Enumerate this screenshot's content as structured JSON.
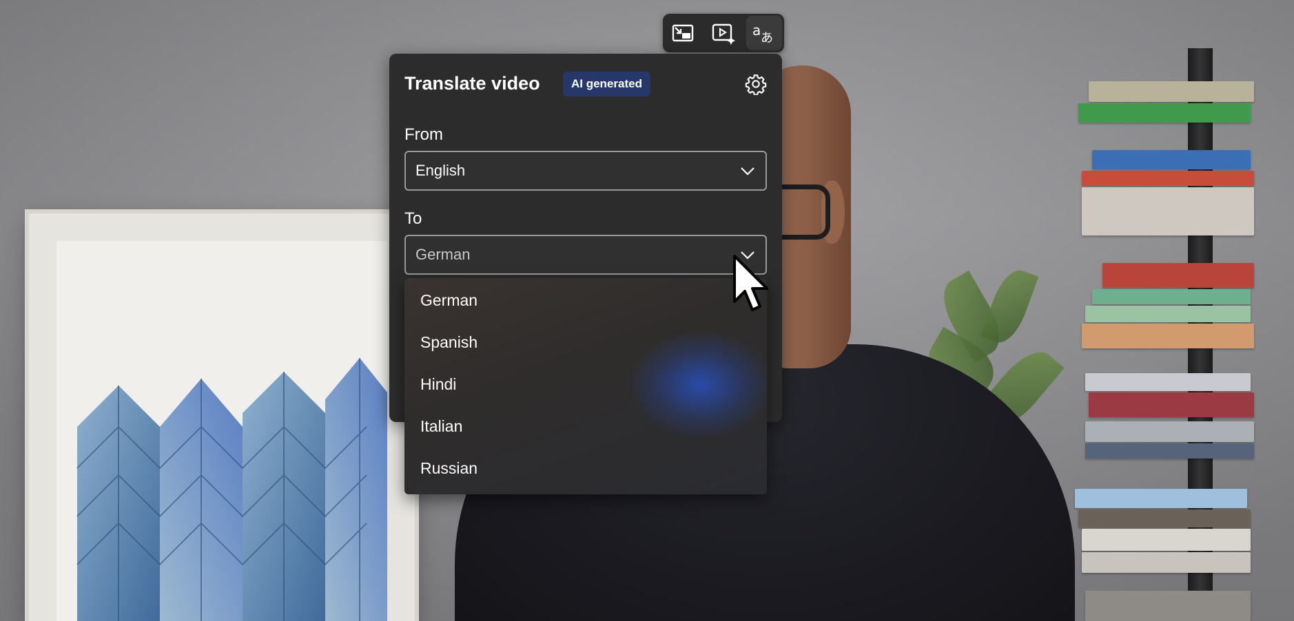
{
  "toolbar": {
    "buttons": [
      {
        "icon": "picture-in-picture-exit-icon",
        "active": false
      },
      {
        "icon": "video-enhance-icon",
        "active": false
      },
      {
        "icon": "translate-icon",
        "active": true
      }
    ]
  },
  "panel": {
    "title": "Translate video",
    "badge": "AI generated",
    "settings_icon": "gear-icon",
    "from_label": "From",
    "from_value": "English",
    "to_label": "To",
    "to_value": "German"
  },
  "dropdown": {
    "options": [
      "German",
      "Spanish",
      "Hindi",
      "Italian",
      "Russian"
    ]
  },
  "colors": {
    "panel_bg": "#2c2c2c",
    "badge_bg": "#26386a",
    "select_border": "#9a9a9a",
    "text": "#ffffff"
  }
}
